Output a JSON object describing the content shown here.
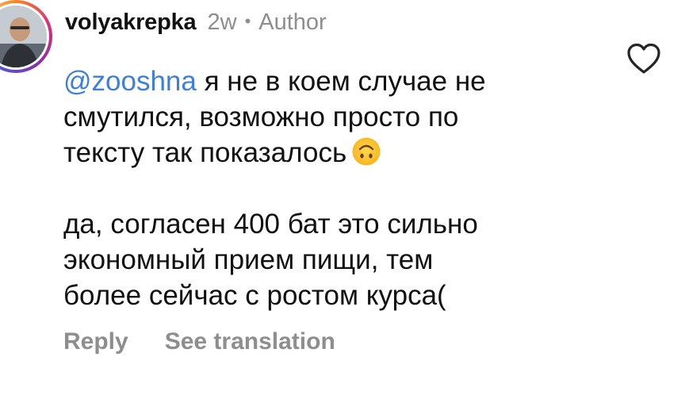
{
  "comment": {
    "username": "volyakrepka",
    "time": "2w",
    "separator": "•",
    "author_badge": "Author",
    "mention": "@zooshna",
    "paragraph_1_lines": [
      " я не в коем случае не",
      "смутился, возможно просто по",
      "тексту так показалось"
    ],
    "emoji": "upside-down-face",
    "paragraph_2_lines": [
      "да, согласен 400 бат это сильно",
      "экономный прием пищи, тем",
      "более сейчас с ростом курса("
    ]
  },
  "actions": {
    "reply": "Reply",
    "see_translation": "See translation"
  },
  "icons": {
    "like": "heart-outline-icon"
  },
  "colors": {
    "mention": "#3d7fd9",
    "muted": "#8e8e8e",
    "text": "#111111"
  }
}
